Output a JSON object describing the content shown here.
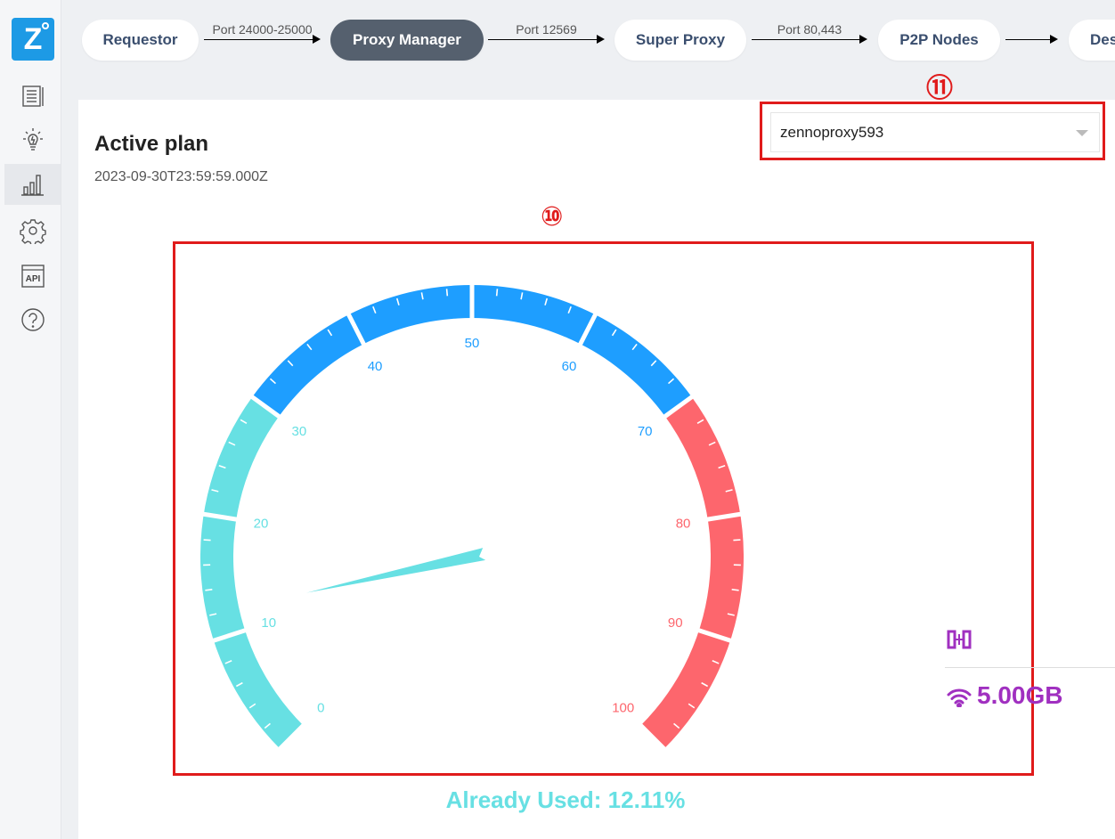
{
  "sidebar": {
    "logo_letter": "Z",
    "items": [
      {
        "icon": "list-icon"
      },
      {
        "icon": "lightbulb-icon"
      },
      {
        "icon": "bar-chart-icon",
        "active": true
      },
      {
        "icon": "gear-icon"
      },
      {
        "icon": "api-icon",
        "label": "API"
      },
      {
        "icon": "help-icon"
      }
    ]
  },
  "pipeline": {
    "nodes": [
      "Requestor",
      "Proxy Manager",
      "Super Proxy",
      "P2P Nodes",
      "Des"
    ],
    "active_node": "Proxy Manager",
    "connectors": [
      "Port 24000-25000",
      "Port 12569",
      "Port 80,443",
      ""
    ]
  },
  "main": {
    "title": "Active plan",
    "expiry": "2023-09-30T23:59:59.000Z",
    "marker_select": "⑪",
    "marker_gauge": "⑩",
    "plan_select": {
      "value": "zennoproxy593"
    }
  },
  "gauge": {
    "min": 0,
    "max": 100,
    "ticks": [
      "0",
      "10",
      "20",
      "30",
      "40",
      "50",
      "60",
      "70",
      "80",
      "90",
      "100"
    ],
    "value_percent": 12.11,
    "used_label": "Already Used: 12.11%",
    "colors": {
      "low": "#67e0e3",
      "mid": "#1e9eff",
      "high": "#fd666d"
    },
    "bands": [
      30,
      70,
      100
    ]
  },
  "stats": {
    "total": "5.00GB",
    "accent_color": "#a030c0"
  }
}
